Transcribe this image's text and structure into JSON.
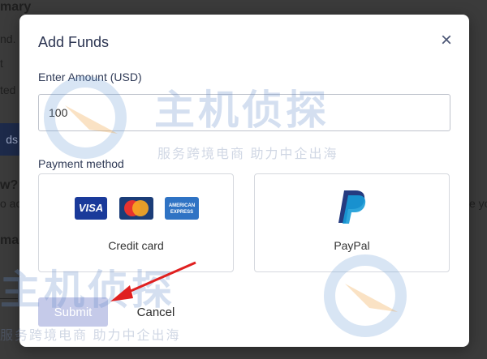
{
  "background": {
    "items": [
      {
        "text": "mary"
      },
      {
        "text": "nd."
      },
      {
        "text": "t"
      },
      {
        "text": "ted"
      },
      {
        "text": "ds"
      },
      {
        "text": "w?"
      },
      {
        "text": "o ac"
      },
      {
        "text": "ma"
      },
      {
        "text": "e yo"
      }
    ]
  },
  "modal": {
    "title": "Add Funds",
    "close_label": "×",
    "amount_label": "Enter Amount (USD)",
    "amount_value": "100",
    "payment_label": "Payment method",
    "methods": [
      {
        "label": "Credit card",
        "logos": [
          "VISA",
          "mastercard",
          "AMERICAN EXPRESS"
        ]
      },
      {
        "label": "PayPal"
      }
    ],
    "submit_label": "Submit",
    "cancel_label": "Cancel"
  },
  "watermark": {
    "brand": "主机侦探",
    "tagline": "服务跨境电商 助力中企出海"
  },
  "colors": {
    "submit_bg": "#c5cae9",
    "title": "#2b3451",
    "arrow": "#e02020"
  }
}
